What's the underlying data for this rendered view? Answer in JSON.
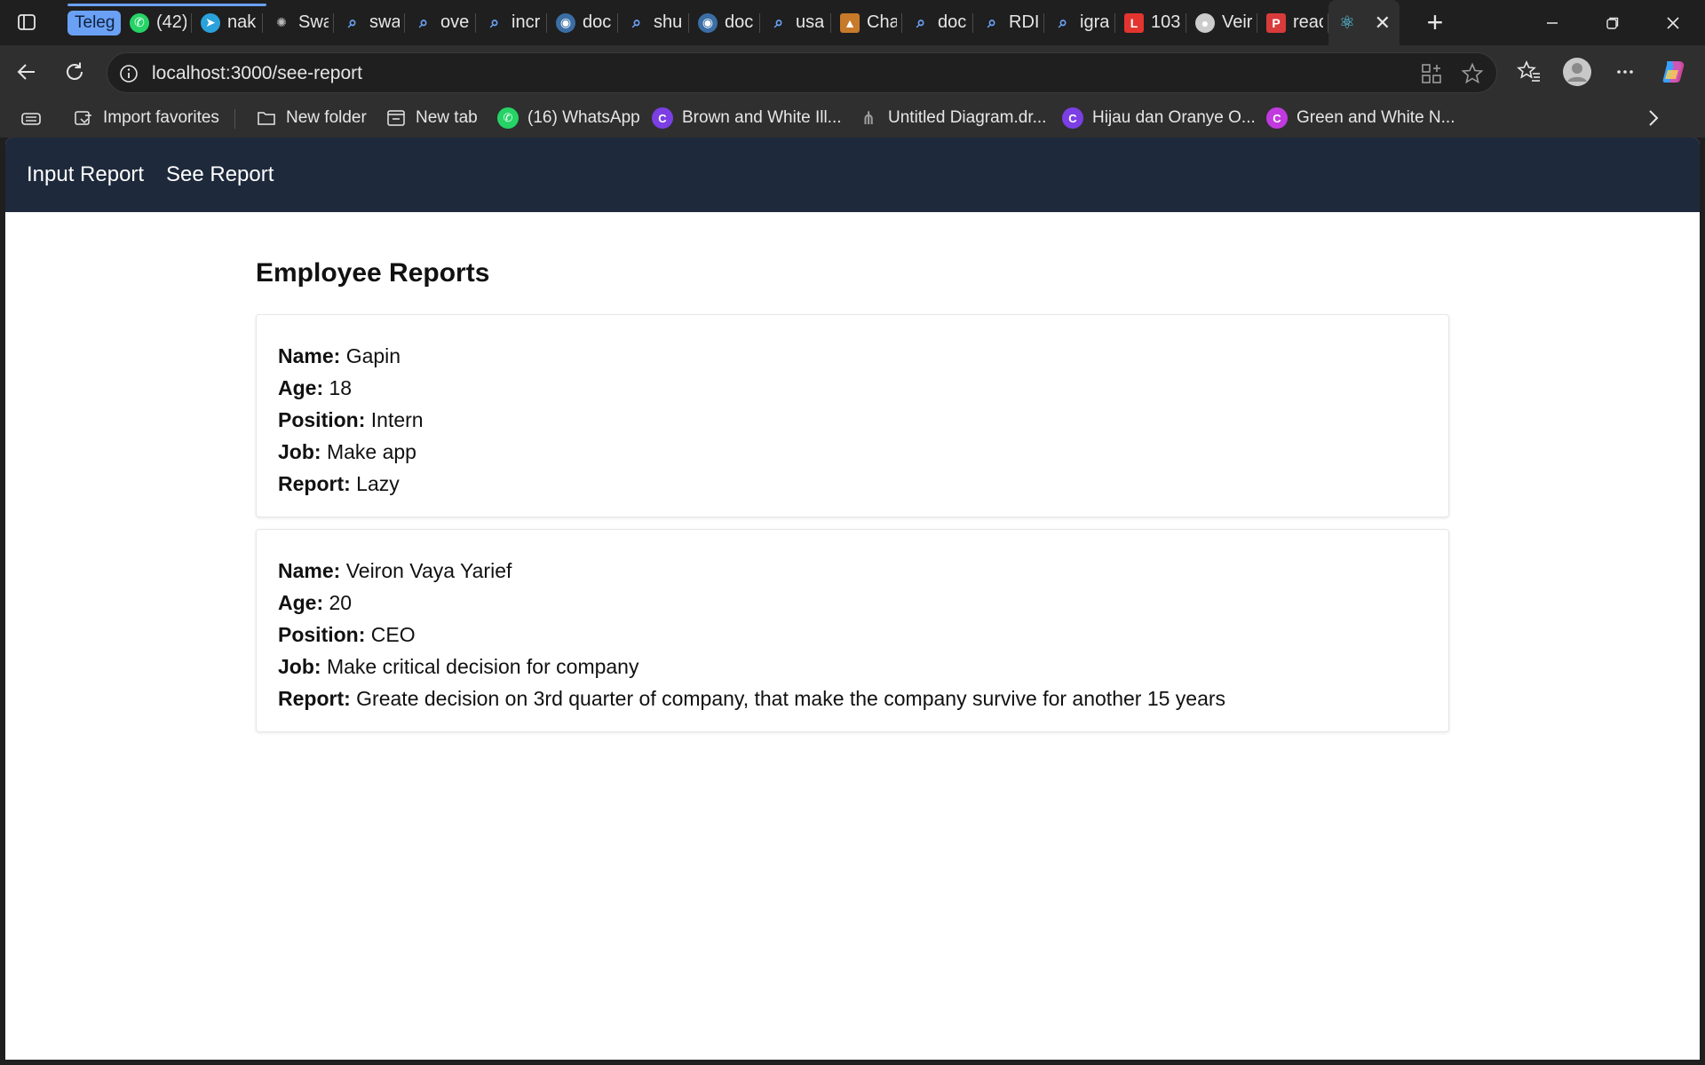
{
  "browser": {
    "tabs": [
      {
        "label": "Teleg",
        "icon": "tab-group-chip",
        "group": true
      },
      {
        "label": "(42)",
        "icon": "whatsapp-icon",
        "color": "#25d366"
      },
      {
        "label": "nak",
        "icon": "telegram-icon",
        "color": "#2aa1da"
      },
      {
        "label": "Swa",
        "icon": "openai-icon",
        "color": "#bbbbbb"
      },
      {
        "label": "swa",
        "icon": "search-icon",
        "color": "#6aa1f5"
      },
      {
        "label": "ove",
        "icon": "search-icon",
        "color": "#6aa1f5"
      },
      {
        "label": "incr",
        "icon": "search-icon",
        "color": "#6aa1f5"
      },
      {
        "label": "doc",
        "icon": "docker-icon",
        "color": "#3a6ea5"
      },
      {
        "label": "shu",
        "icon": "search-icon",
        "color": "#6aa1f5"
      },
      {
        "label": "doc",
        "icon": "docker-icon",
        "color": "#3a6ea5"
      },
      {
        "label": "usa",
        "icon": "search-icon",
        "color": "#6aa1f5"
      },
      {
        "label": "Cha",
        "icon": "diagram-icon",
        "color": "#c77a2a"
      },
      {
        "label": "doc",
        "icon": "search-icon",
        "color": "#6aa1f5"
      },
      {
        "label": "RDI",
        "icon": "search-icon",
        "color": "#6aa1f5"
      },
      {
        "label": "igra",
        "icon": "search-icon",
        "color": "#6aa1f5"
      },
      {
        "label": "103",
        "icon": "laravel-icon",
        "color": "#e3342f"
      },
      {
        "label": "Veir",
        "icon": "github-icon",
        "color": "#cccccc"
      },
      {
        "label": "reac",
        "icon": "pdf-icon",
        "color": "#d83b3b"
      },
      {
        "label": "",
        "icon": "react-icon",
        "color": "#61dafb",
        "active": true
      }
    ],
    "address": "localhost:3000/see-report",
    "bookmarks": [
      {
        "label": "Import favorites",
        "icon": "import-icon"
      },
      {
        "label": "New folder",
        "icon": "folder-icon"
      },
      {
        "label": "New tab",
        "icon": "newtab-icon"
      },
      {
        "label": "(16) WhatsApp",
        "icon": "whatsapp-icon",
        "color": "#25d366"
      },
      {
        "label": "Brown and White Ill...",
        "icon": "canva-icon",
        "color": "#7b3fe4"
      },
      {
        "label": "Untitled Diagram.dr...",
        "icon": "diagram-icon",
        "color": "#999999"
      },
      {
        "label": "Hijau dan Oranye O...",
        "icon": "canva-icon",
        "color": "#7b3fe4"
      },
      {
        "label": "Green and White N...",
        "icon": "canva-icon",
        "color": "#c13ae0"
      }
    ]
  },
  "app": {
    "nav": {
      "input_report": "Input Report",
      "see_report": "See Report"
    },
    "title": "Employee Reports",
    "labels": {
      "name": "Name:",
      "age": "Age:",
      "position": "Position:",
      "job": "Job:",
      "report": "Report:"
    },
    "reports": [
      {
        "name": "Gapin",
        "age": "18",
        "position": "Intern",
        "job": "Make app",
        "report": "Lazy"
      },
      {
        "name": "Veiron Vaya Yarief",
        "age": "20",
        "position": "CEO",
        "job": "Make critical decision for company",
        "report": "Greate decision on 3rd quarter of company, that make the company survive for another 15 years"
      }
    ]
  },
  "colors": {
    "navbar": "#1e293b",
    "browser_chrome": "#1f1f1f",
    "toolbar": "#2f2f2f",
    "tab_group": "#6aa1f5"
  }
}
